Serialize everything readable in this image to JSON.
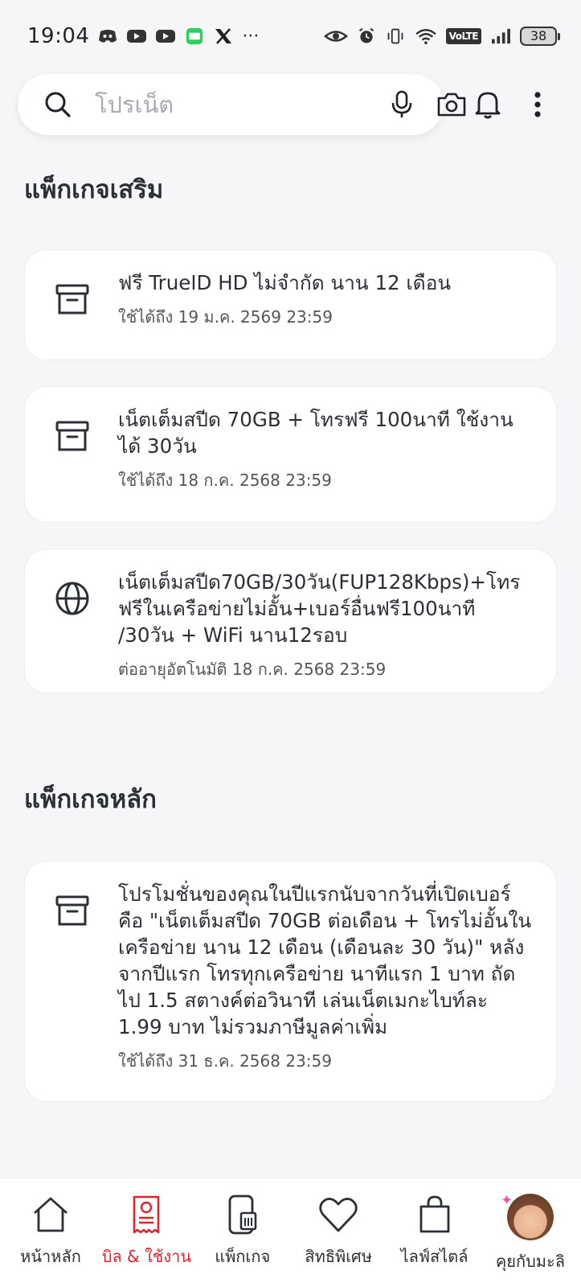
{
  "status_bar": {
    "time": "19:04",
    "left_icons": [
      "discord-icon",
      "youtube-icon",
      "youtube-icon",
      "webtoon-icon",
      "x-icon",
      "more-notifications-icon"
    ],
    "right_icons": [
      "eye-icon",
      "alarm-icon",
      "vibrate-icon",
      "wifi-icon",
      "volte-icon",
      "signal-icon",
      "battery-icon"
    ],
    "more": "···",
    "volte": "VoLTE",
    "battery": "38"
  },
  "search": {
    "placeholder": "โปรเน็ต"
  },
  "sections": [
    {
      "title": "แพ็กเกจเสริม",
      "items": [
        {
          "icon": "archive-box-icon",
          "title": "ฟรี TrueID HD ไม่จำกัด นาน 12 เดือน",
          "subtitle": "ใช้ได้ถึง 19 ม.ค. 2569 23:59"
        },
        {
          "icon": "archive-box-icon",
          "title": "เน็ตเต็มสปีด 70GB + โทรฟรี 100นาที ใช้งานได้ 30วัน",
          "subtitle": "ใช้ได้ถึง 18 ก.ค. 2568 23:59"
        },
        {
          "icon": "globe-icon",
          "title": "เน็ตเต็มสปีด70GB/30วัน(FUP128Kbps)+โทรฟรีในเครือข่ายไม่อั้น+เบอร์อื่นฟรี100นาที /30วัน + WiFi นาน12รอบ",
          "subtitle": "ต่ออายุอัตโนมัติ 18 ก.ค. 2568 23:59"
        }
      ]
    },
    {
      "title": "แพ็กเกจหลัก",
      "items": [
        {
          "icon": "archive-box-icon",
          "title": "โปรโมชั่นของคุณในปีแรกนับจากวันที่เปิดเบอร์ คือ \"เน็ตเต็มสปีด 70GB ต่อเดือน + โทรไม่อั้นในเครือข่าย นาน 12 เดือน (เดือนละ 30 วัน)\" หลังจากปีแรก โทรทุกเครือข่าย นาทีแรก 1 บาท ถัดไป 1.5 สตางค์ต่อวินาที เล่นเน็ตเมกะไบท์ละ 1.99 บาท ไม่รวมภาษีมูลค่าเพิ่ม",
          "subtitle": "ใช้ได้ถึง 31 ธ.ค. 2568 23:59"
        }
      ]
    }
  ],
  "bottom_nav": [
    {
      "label": "หน้าหลัก",
      "icon": "home-icon",
      "active": false
    },
    {
      "label": "บิล & ใช้งาน",
      "icon": "bill-icon",
      "active": true
    },
    {
      "label": "แพ็กเกจ",
      "icon": "package-phone-icon",
      "active": false
    },
    {
      "label": "สิทธิพิเศษ",
      "icon": "heart-icon",
      "active": false
    },
    {
      "label": "ไลฟ์สไตล์",
      "icon": "shopping-bag-icon",
      "active": false
    },
    {
      "label": "คุยกับมะลิ",
      "icon": "mali-avatar-icon",
      "active": false
    }
  ],
  "colors": {
    "accent": "#e0242f",
    "background": "#f6f6f8",
    "text": "#2b2f36"
  }
}
